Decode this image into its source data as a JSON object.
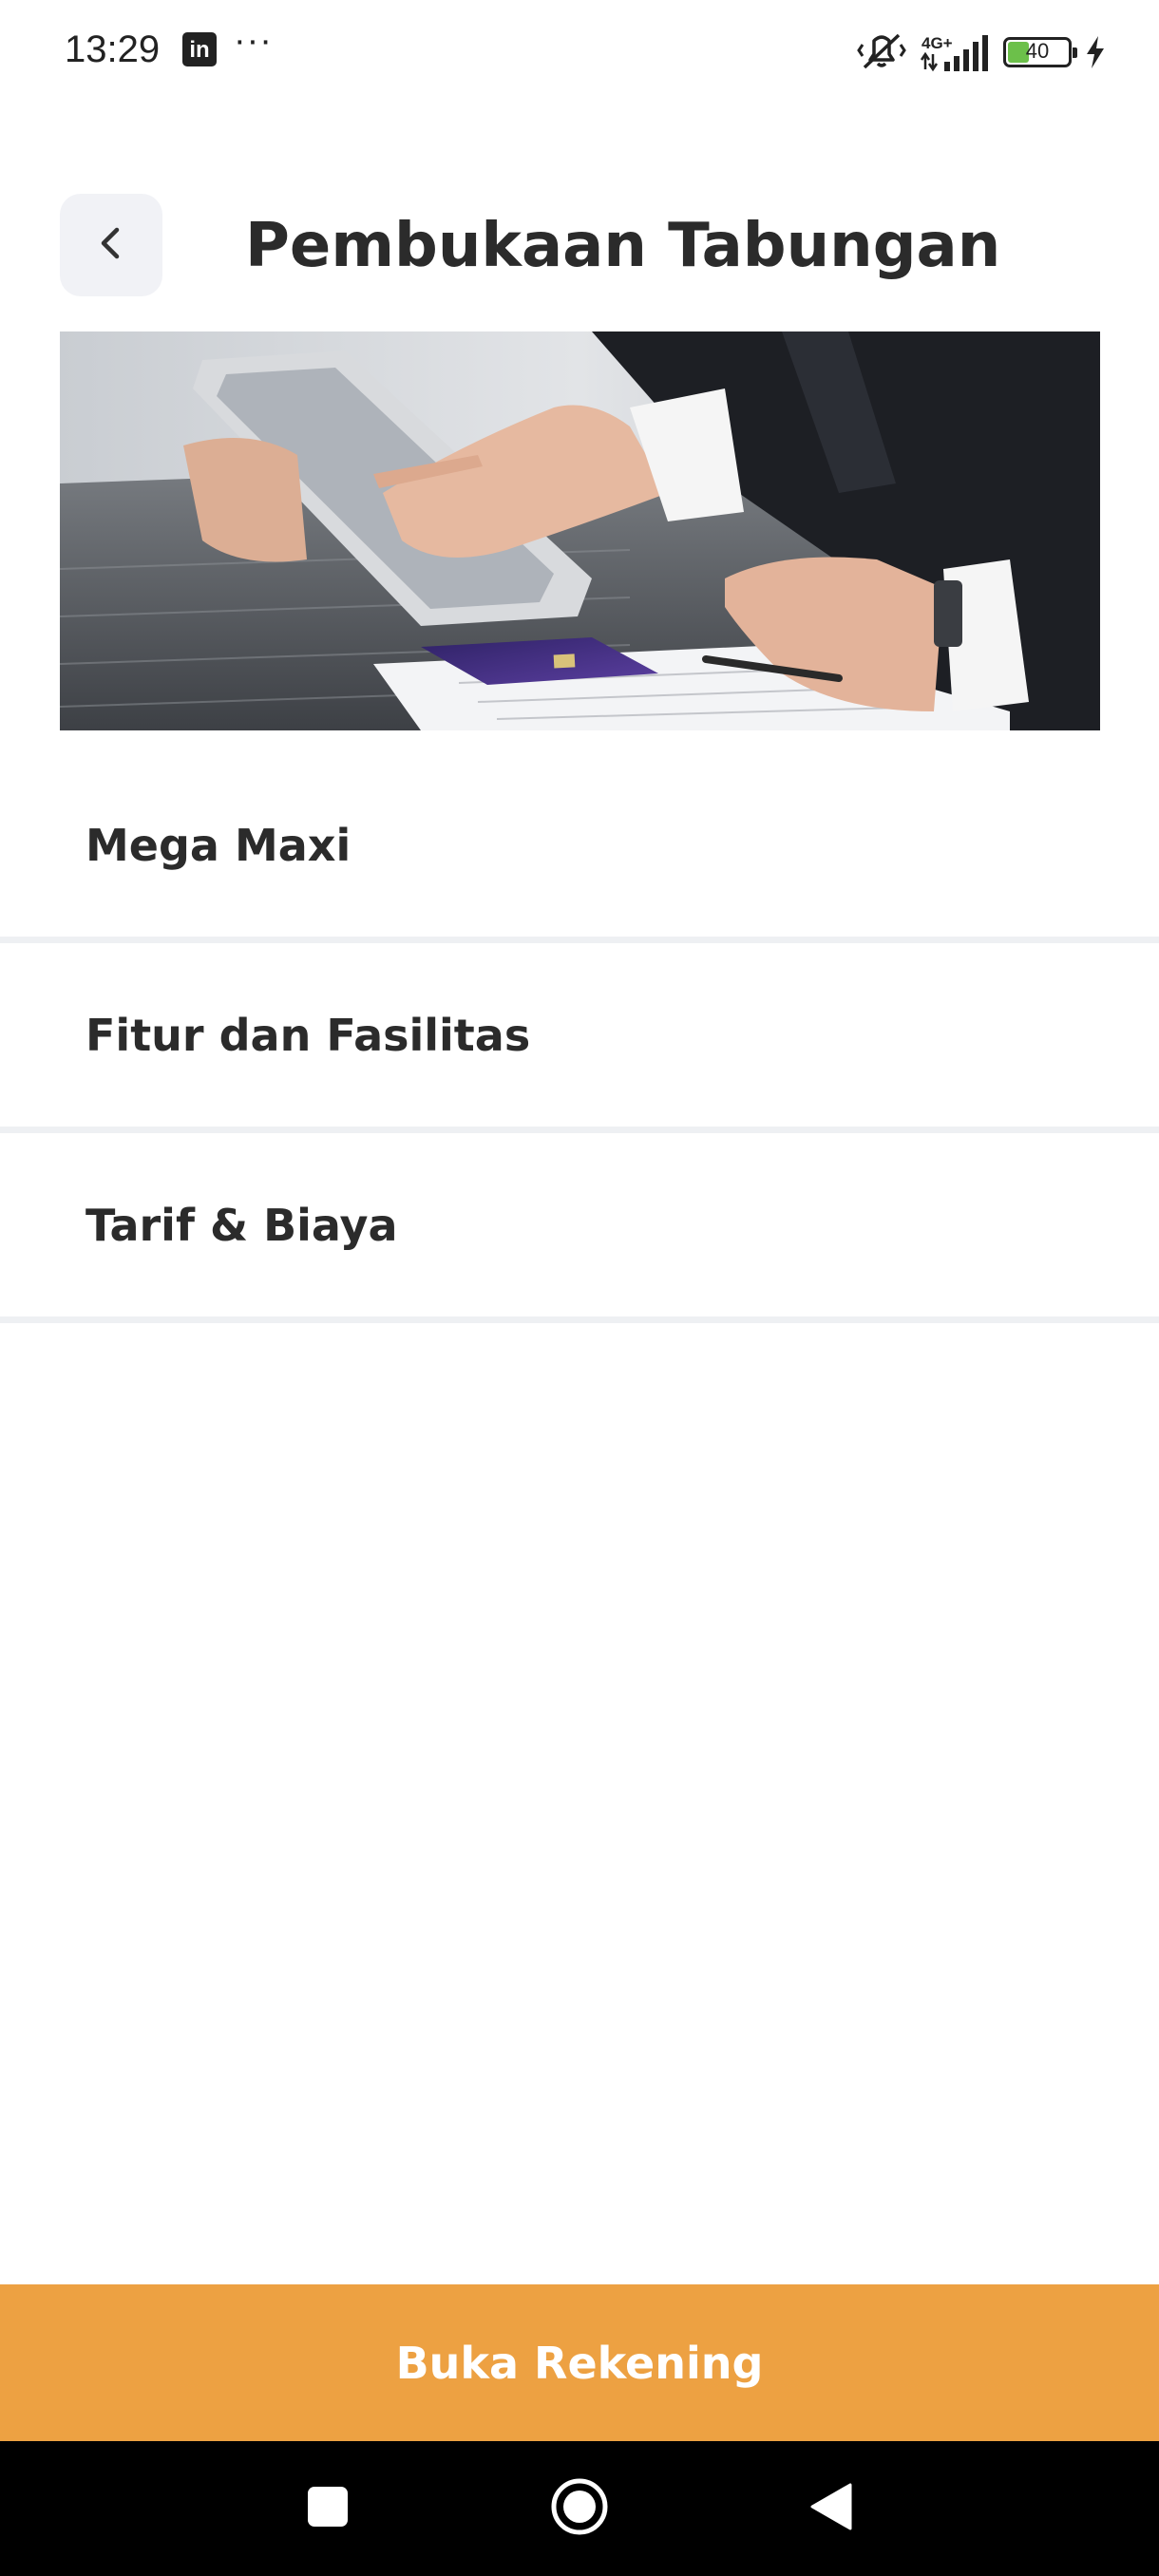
{
  "status_bar": {
    "time": "13:29",
    "linkedin_glyph": "in",
    "more_glyph": "···",
    "network_label": "4G+",
    "battery_level": "40",
    "icons": [
      "linkedin-icon",
      "more-notifications-icon",
      "vibrate-silent-icon",
      "signal-icon",
      "battery-icon",
      "charging-icon"
    ]
  },
  "header": {
    "title": "Pembukaan Tabungan",
    "back_icon": "chevron-left-icon"
  },
  "sections": [
    {
      "label": "Mega Maxi"
    },
    {
      "label": "Fitur dan Fasilitas"
    },
    {
      "label": "Tarif & Biaya"
    }
  ],
  "cta": {
    "label": "Buka Rekening"
  },
  "nav_bar": {
    "icons": [
      "recents-square-icon",
      "home-circle-icon",
      "back-triangle-icon"
    ]
  },
  "colors": {
    "accent": "#eda142",
    "back_button_bg": "#f1f2f6",
    "divider": "#eef0f3",
    "text": "#2b2b2b",
    "battery_fill": "#6cc04a"
  }
}
